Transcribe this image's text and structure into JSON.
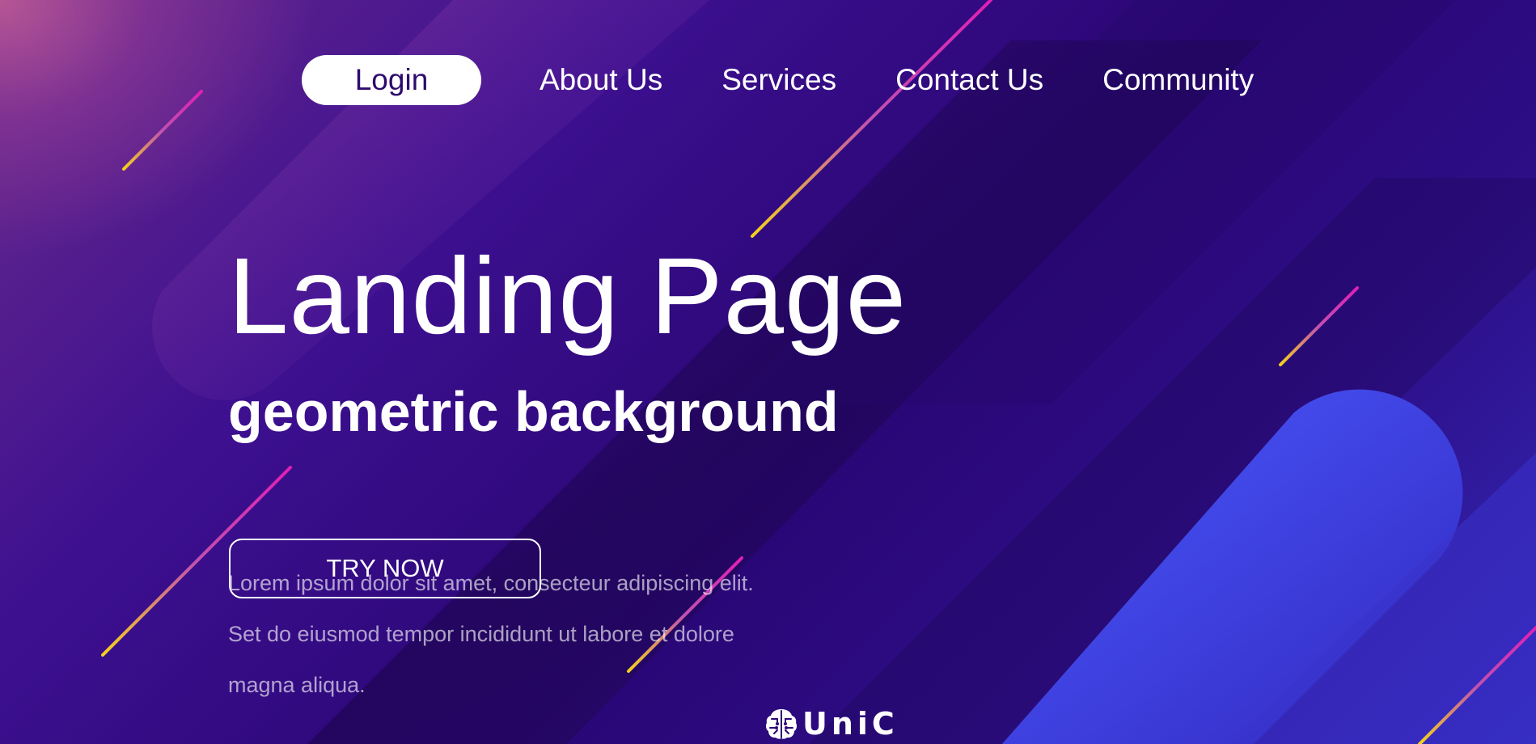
{
  "nav": {
    "login_label": "Login",
    "links": [
      {
        "label": "About Us"
      },
      {
        "label": "Services"
      },
      {
        "label": "Contact Us"
      },
      {
        "label": "Community"
      }
    ]
  },
  "hero": {
    "title": "Landing Page",
    "subtitle": "geometric background",
    "description_lines": [
      "Lorem ipsum dolor sit amet, consecteur adipiscing elit.",
      "Set do eiusmod tempor incididunt ut labore et dolore",
      "magna aliqua."
    ],
    "cta_label": "TRY NOW"
  },
  "logo": {
    "text": "UniC",
    "icon": "brain-circuit-icon"
  },
  "colors": {
    "background_dark": "#2a0675",
    "background_accent_blue": "#4a5cff",
    "background_glow_pink": "#be5a96",
    "streak_pink": "#e11fb4",
    "streak_yellow": "#f5d21c",
    "login_text": "#2e0b6e",
    "text": "#ffffff"
  }
}
